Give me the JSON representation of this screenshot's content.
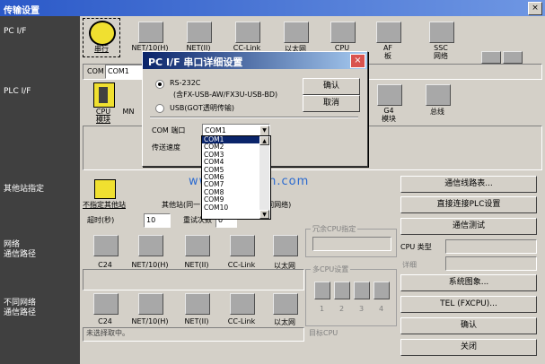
{
  "window": {
    "title": "传输设置",
    "close_glyph": "×"
  },
  "left_labels": {
    "pc_if": "PC I/F",
    "plc_if": "PLC I/F",
    "other_station": "其他站指定",
    "network_route": [
      "网络",
      "通信路径"
    ],
    "diff_network_route": [
      "不同网络",
      "通信路径"
    ]
  },
  "pc_if": {
    "items": [
      {
        "label": "串行",
        "selected": true
      },
      {
        "label": "NET/10(H)"
      },
      {
        "label": "NET(II)"
      },
      {
        "label": "CC-Link"
      },
      {
        "label": "以太网"
      },
      {
        "label": "CPU"
      },
      {
        "label": "AF\n板"
      },
      {
        "label": "SSC\n网络"
      }
    ],
    "com_label": "COM",
    "com_value": "COM1"
  },
  "plc_if": {
    "items": [
      {
        "label": "CPU\n模块"
      },
      {
        "label": "MN"
      },
      {
        "label": "G4\n模块"
      },
      {
        "label": "总线"
      }
    ]
  },
  "other_station": {
    "no_station": "不指定其他站",
    "same_net": "其他站(同一",
    "diff_net": "其他站(不同网络)",
    "timeout_label": "超时(秒)",
    "timeout_value": "10",
    "retry_label": "重试次数",
    "retry_value": "0"
  },
  "network_route": {
    "items": [
      "C24",
      "NET/10(H)",
      "NET(II)",
      "CC-Link",
      "以太网"
    ]
  },
  "diff_network_route": {
    "items": [
      "C24",
      "NET/10(H)",
      "NET(II)",
      "CC-Link",
      "以太网"
    ]
  },
  "redundant_cpu": {
    "label": "冗余CPU指定"
  },
  "multi_cpu": {
    "label": "多CPU设置",
    "numbers": [
      "1",
      "2",
      "3",
      "4"
    ],
    "target_cpu": "目标CPU"
  },
  "right_buttons": {
    "station_list": "通信线路表...",
    "direct_plc": "直接连接PLC设置",
    "comm_test": "通信测试",
    "cpu_type_label": "CPU 类型",
    "detail_label": "详细",
    "system_image": "系统图象...",
    "tel": "TEL (FXCPU)...",
    "ok": "确认",
    "close": "关闭"
  },
  "status_text": "未选择取中。",
  "dialog": {
    "title": "PC I/F 串口详细设置",
    "close_glyph": "×",
    "rs232c_label": "RS-232C",
    "rs232c_sub": "(含FX-USB-AW/FX3U-USB-BD)",
    "usb_label": "USB(GOT透明传输)",
    "ok": "确认",
    "cancel": "取消",
    "com_port_label": "COM 端口",
    "com_port_value": "COM1",
    "baud_label": "传送速度",
    "com_options": [
      "COM1",
      "COM2",
      "COM3",
      "COM4",
      "COM5",
      "COM6",
      "COM7",
      "COM8",
      "COM9",
      "COM10"
    ]
  },
  "watermark": "www.diangon.com",
  "colors": {
    "title_blue": "#2b59c8",
    "dialog_title": "#0a246a",
    "selection": "#0a246a",
    "left_pane": "#404040",
    "close_red": "#d9534f"
  }
}
